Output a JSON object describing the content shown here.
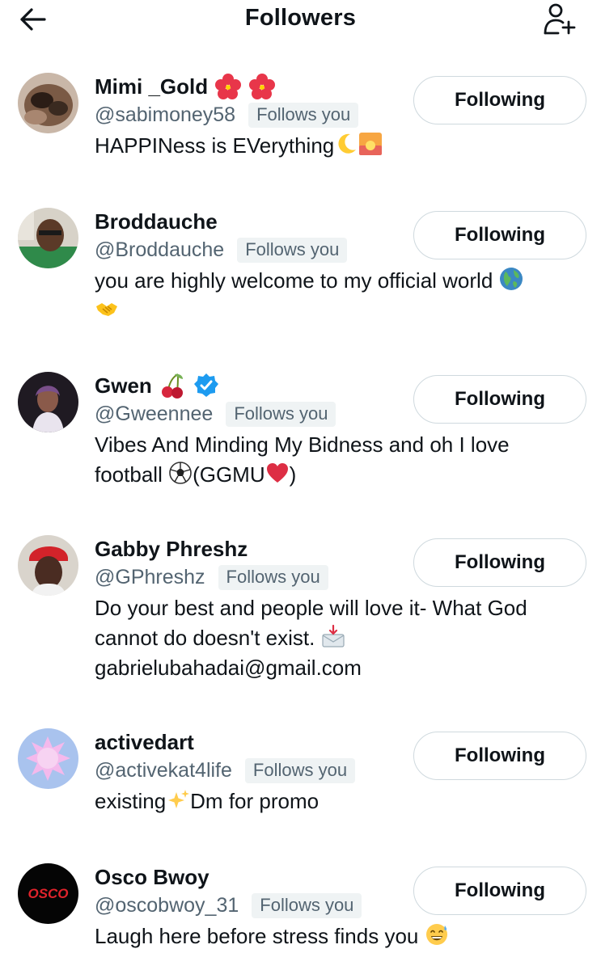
{
  "header": {
    "title": "Followers",
    "back_icon": "arrow-left-icon",
    "add_icon": "person-add-icon"
  },
  "follows_badge": "Follows you",
  "button_label": "Following",
  "followers": [
    {
      "name": "Mimi _Gold",
      "handle": "@sabimoney58",
      "bio": "HAPPINess is EVerything",
      "name_icons": [
        "hibiscus-icon",
        "hibiscus-icon"
      ],
      "bio_icons": [
        "crescent-moon-icon",
        "sunrise-icon"
      ]
    },
    {
      "name": "Broddauche",
      "handle": "@Broddauche",
      "bio_line1": "you are highly welcome to my official world",
      "bio_icons": [
        "globe-icon",
        "handshake-icon"
      ]
    },
    {
      "name": "Gwen",
      "handle": "@Gweennee",
      "bio_line1": "Vibes And Minding My Bidness and oh I love",
      "bio_line2a": "football",
      "bio_line2b": "(GGMU",
      "bio_line2c": ")",
      "name_icons": [
        "cherries-icon",
        "verified-badge-icon"
      ],
      "bio_icons": [
        "soccer-ball-icon",
        "red-heart-icon"
      ]
    },
    {
      "name": "Gabby Phreshz",
      "handle": "@GPhreshz",
      "bio_line1": "Do your best and people will love it- What God",
      "bio_line2": "cannot do doesn't exist.",
      "bio_line3": "gabrielubahadai@gmail.com",
      "bio_icons": [
        "envelope-arrow-icon"
      ]
    },
    {
      "name": "activedart",
      "handle": "@activekat4life",
      "bio_a": "existing",
      "bio_b": "Dm for promo",
      "bio_icons": [
        "sparkles-icon"
      ]
    },
    {
      "name": "Osco Bwoy",
      "handle": "@oscobwoy_31",
      "bio": "Laugh here before stress finds you",
      "avatar_text": "OSCO",
      "bio_icons": [
        "sweat-smile-icon"
      ]
    }
  ],
  "colors": {
    "text": "#0f1419",
    "secondary": "#536471",
    "badge_bg": "#eff3f4",
    "border": "#cfd9de",
    "verified": "#1d9bf0"
  }
}
